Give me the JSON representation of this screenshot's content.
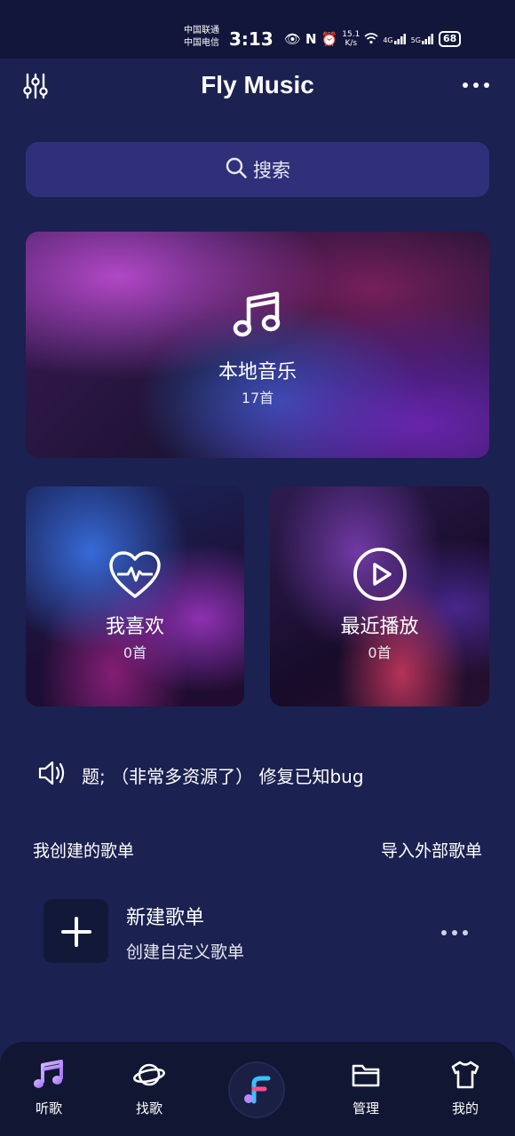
{
  "status_bar": {
    "carrier_1": "中国联通",
    "carrier_2": "中国电信",
    "time": "3:13",
    "net_speed_value": "15.1",
    "net_speed_unit": "K/s",
    "signal_1_label": "4G",
    "signal_2_label": "5G",
    "battery": "68"
  },
  "header": {
    "title": "Fly Music",
    "left_icon": "equalizer-icon",
    "right_icon": "more-icon"
  },
  "search": {
    "label": "搜索",
    "icon": "search-icon"
  },
  "cards": {
    "local": {
      "title": "本地音乐",
      "count": "17首",
      "icon": "music-note-icon"
    },
    "favorite": {
      "title": "我喜欢",
      "count": "0首",
      "icon": "heart-pulse-icon"
    },
    "recent": {
      "title": "最近播放",
      "count": "0首",
      "icon": "play-circle-icon"
    }
  },
  "notice": {
    "icon": "speaker-icon",
    "text": "题; （非常多资源了） 修复已知bug"
  },
  "playlists": {
    "section_title": "我创建的歌单",
    "import_label": "导入外部歌单",
    "items": [
      {
        "name": "新建歌单",
        "desc": "创建自定义歌单"
      }
    ]
  },
  "nav": {
    "items": [
      {
        "label": "听歌",
        "icon": "music-note-icon"
      },
      {
        "label": "找歌",
        "icon": "planet-icon"
      },
      {
        "label": "",
        "icon": "fly-logo-icon"
      },
      {
        "label": "管理",
        "icon": "folder-icon"
      },
      {
        "label": "我的",
        "icon": "tshirt-icon"
      }
    ]
  },
  "colors": {
    "background": "#1b2150",
    "search_bg": "#30307a",
    "nav_bg": "#111633",
    "accent_purple": "#b48cff",
    "accent_pink": "#ff4d8d",
    "accent_blue": "#35c2ff"
  }
}
